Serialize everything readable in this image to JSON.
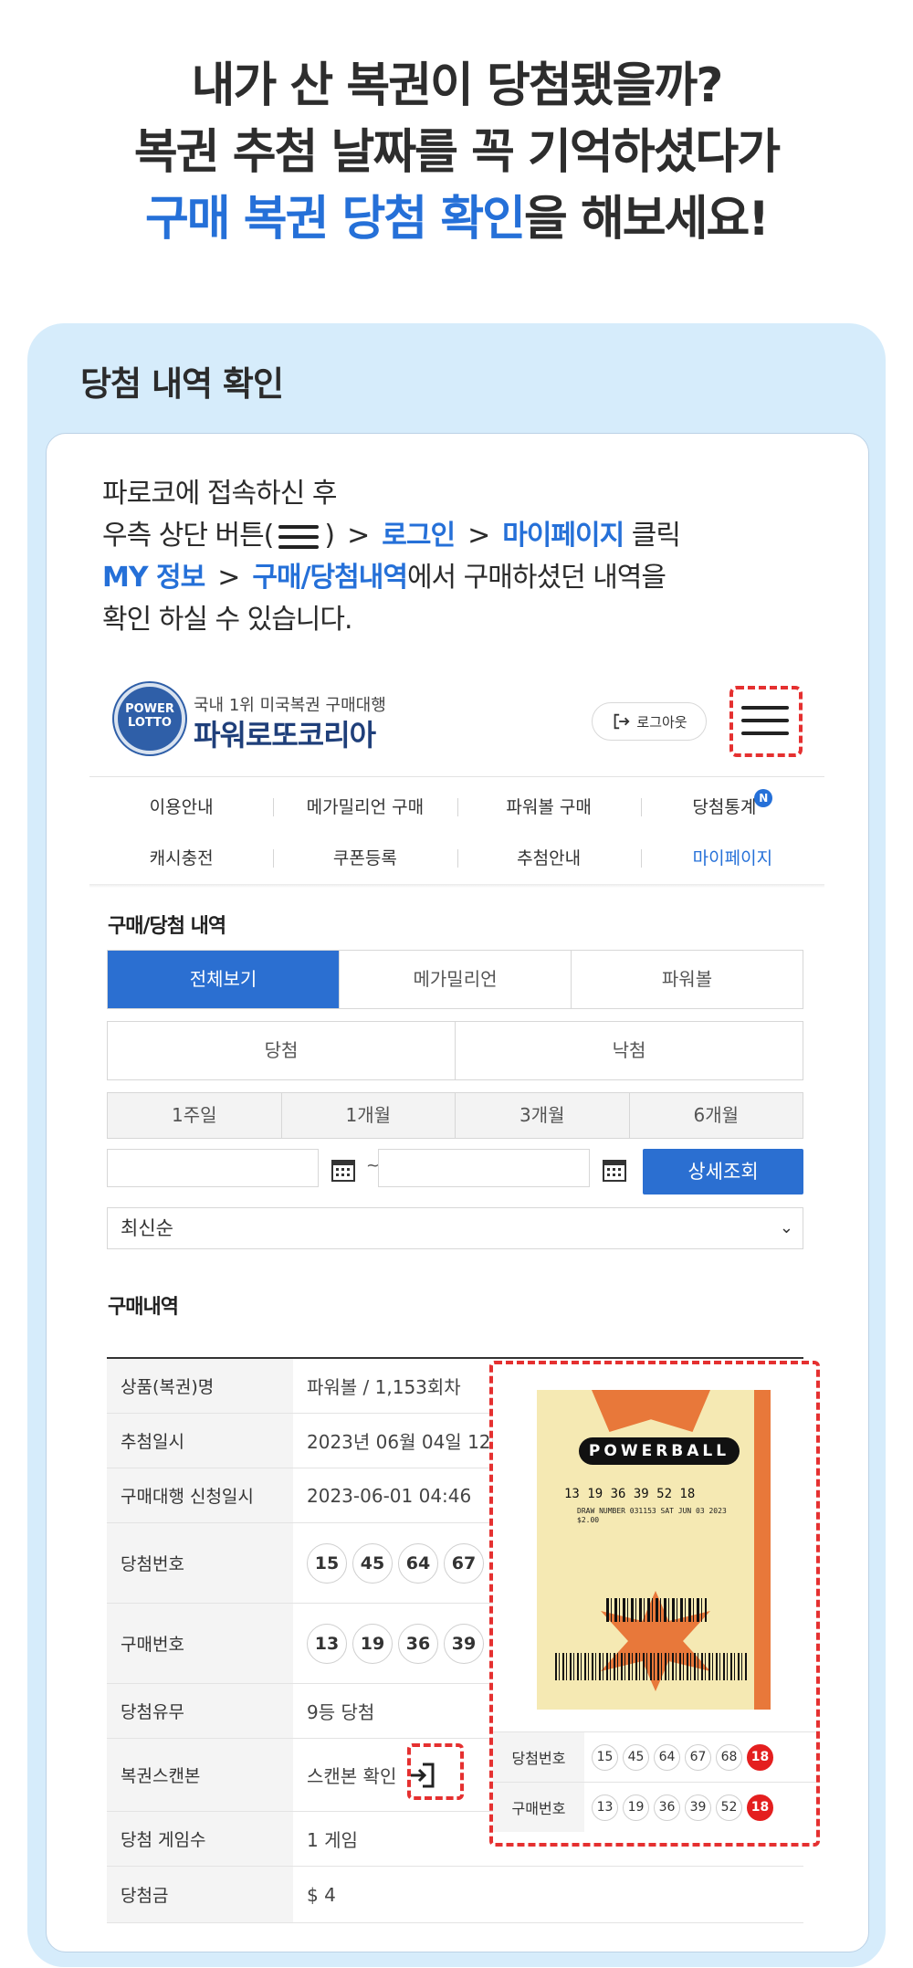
{
  "hero": {
    "line1": "내가 산 복권이 당첨됐을까?",
    "line2": "복권 추첨 날짜를 꼭 기억하셨다가",
    "line3_highlight": "구매 복권 당첨 확인",
    "line3_rest": "을 해보세요!"
  },
  "panel": {
    "title": "당첨 내역 확인"
  },
  "guide": {
    "line1": "파로코에 접속하신 후",
    "line2_a": "우측 상단 버튼(",
    "line2_b": ")",
    "sep": ">",
    "login": "로그인",
    "mypage": "마이페이지",
    "click": "클릭",
    "myinfo": "MY 정보",
    "history": "구매/당첨내역",
    "line3_rest": "에서 구매하셨던 내역을",
    "line4": "확인 하실 수 있습니다."
  },
  "site": {
    "logo_line1": "POWER",
    "logo_line2": "LOTTO",
    "tagline": "국내 1위 미국복권 구매대행",
    "name": "파워로또코리아",
    "logout": "로그아웃"
  },
  "nav_row1": [
    "이용안내",
    "메가밀리언 구매",
    "파워볼 구매",
    "당첨통계"
  ],
  "nav_badge": "N",
  "nav_row2": [
    "캐시충전",
    "쿠폰등록",
    "추첨안내",
    "마이페이지"
  ],
  "history": {
    "title": "구매/당첨 내역",
    "tabs": [
      "전체보기",
      "메가밀리언",
      "파워볼"
    ],
    "result_tabs": [
      "당첨",
      "낙첨"
    ],
    "periods": [
      "1주일",
      "1개월",
      "3개월",
      "6개월"
    ],
    "tilde": "~",
    "search_button": "상세조회",
    "sort": "최신순"
  },
  "purchase": {
    "title": "구매내역",
    "rows": {
      "product": {
        "label": "상품(복권)명",
        "value": "파워볼 / 1,153회차"
      },
      "draw_date": {
        "label": "추첨일시",
        "value": "2023년 06월 04일 12:0"
      },
      "apply_date": {
        "label": "구매대행 신청일시",
        "value": "2023-06-01 04:46"
      },
      "win_numbers": {
        "label": "당첨번호",
        "balls": [
          "15",
          "45",
          "64",
          "67"
        ]
      },
      "buy_numbers": {
        "label": "구매번호",
        "balls": [
          "13",
          "19",
          "36",
          "39"
        ]
      },
      "result": {
        "label": "당첨유무",
        "value": "9등 당첨"
      },
      "scan": {
        "label": "복권스캔본",
        "value": "스캔본 확인"
      },
      "games": {
        "label": "당첨 게임수",
        "value": "1 게임"
      },
      "prize": {
        "label": "당첨금",
        "value": "$ 4"
      }
    }
  },
  "popup": {
    "ticket_logo": "POWERBALL",
    "ticket_numbers": "13 19 36 39 52  18",
    "ticket_small": "DRAW NUMBER 031153 SAT JUN 03 2023  $2.00",
    "win_label": "당첨번호",
    "win_balls": [
      "15",
      "45",
      "64",
      "67",
      "68"
    ],
    "win_power": "18",
    "buy_label": "구매번호",
    "buy_balls": [
      "13",
      "19",
      "36",
      "39",
      "52"
    ],
    "buy_power": "18"
  }
}
